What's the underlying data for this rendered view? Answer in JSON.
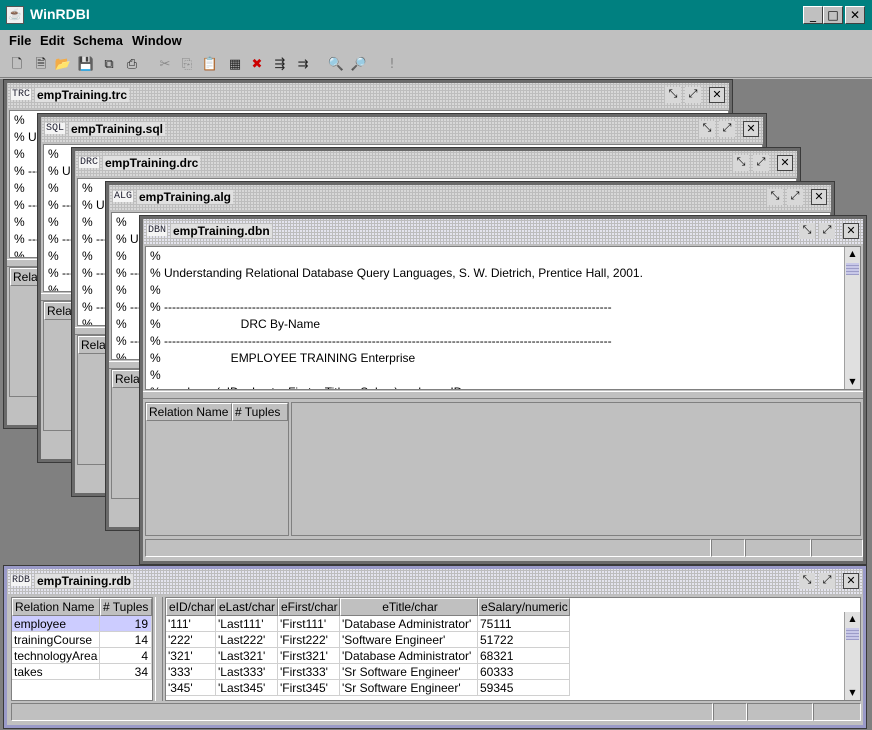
{
  "app": {
    "title": "WinRDBI"
  },
  "menu": [
    "File",
    "Edit",
    "Schema",
    "Window"
  ],
  "toolbar": {
    "icons": [
      "new-file-icon",
      "new-query-icon",
      "open-icon",
      "save-icon",
      "save-all-icon",
      "print-icon",
      "cut-icon",
      "copy-icon",
      "paste-icon",
      "insert-row-icon",
      "delete-row-icon",
      "split-icon",
      "merge-icon",
      "preview-icon",
      "find-icon",
      "execute-icon"
    ]
  },
  "frames": {
    "trc": {
      "badge": "TRC",
      "title": "empTraining.trc",
      "relation_partial": "Rela"
    },
    "sql": {
      "badge": "SQL",
      "title": "empTraining.sql",
      "relation_partial": "Rela"
    },
    "drc": {
      "badge": "DRC",
      "title": "empTraining.drc",
      "relation_partial": "Rela"
    },
    "alg": {
      "badge": "ALG",
      "title": "empTraining.alg",
      "relation_partial": "Rela"
    },
    "back_lines": {
      "trc": [
        "%",
        "% Ur",
        "%",
        "% ---",
        "%",
        "% ---",
        "%",
        "% ---",
        "%",
        "% ---",
        "%"
      ],
      "sql": [
        "%",
        "% Ur",
        "%",
        "% ---",
        "%",
        "% ---",
        "%",
        "% ---",
        "%",
        "% ---"
      ],
      "drc": [
        "%",
        "% Ur",
        "%",
        "% ---",
        "%",
        "% ---",
        "%",
        "% ---",
        "%"
      ],
      "alg": [
        "%",
        "% Ur",
        "%",
        "% ---",
        "%",
        "% ---",
        "%",
        "% ---",
        "%"
      ]
    },
    "dbn": {
      "badge": "DBN",
      "title": "empTraining.dbn",
      "lines": [
        "%",
        "% Understanding Relational Database Query Languages, S. W. Dietrich, Prentice Hall, 2001.",
        "%",
        "% ----------------------------------------------------------------------------------------------------------------",
        "%                        DRC By-Name",
        "% ----------------------------------------------------------------------------------------------------------------",
        "%                     EMPLOYEE TRAINING Enterprise",
        "%",
        "% employee(eID, eLast, eFirst, eTitle, eSalary)      key: eID"
      ],
      "relation_header": [
        "Relation Name",
        "# Tuples"
      ]
    },
    "rdb": {
      "badge": "RDB",
      "title": "empTraining.rdb",
      "relation_header": [
        "Relation Name",
        "# Tuples"
      ],
      "relations": [
        {
          "name": "employee",
          "tuples": "19"
        },
        {
          "name": "trainingCourse",
          "tuples": "14"
        },
        {
          "name": "technologyArea",
          "tuples": "4"
        },
        {
          "name": "takes",
          "tuples": "34"
        }
      ],
      "columns": [
        "eID/char",
        "eLast/char",
        "eFirst/char",
        "eTitle/char",
        "eSalary/numeric"
      ],
      "rows": [
        [
          "'111'",
          "'Last111'",
          "'First111'",
          "'Database Administrator'",
          "75111"
        ],
        [
          "'222'",
          "'Last222'",
          "'First222'",
          "'Software Engineer'",
          "51722"
        ],
        [
          "'321'",
          "'Last321'",
          "'First321'",
          "'Database Administrator'",
          "68321"
        ],
        [
          "'333'",
          "'Last333'",
          "'First333'",
          "'Sr Software Engineer'",
          "60333"
        ],
        [
          "'345'",
          "'Last345'",
          "'First345'",
          "'Sr Software Engineer'",
          "59345"
        ]
      ]
    }
  },
  "colors": {
    "title_bar": "#008080",
    "desktop": "#808080",
    "selected_row": "#ccccff"
  }
}
